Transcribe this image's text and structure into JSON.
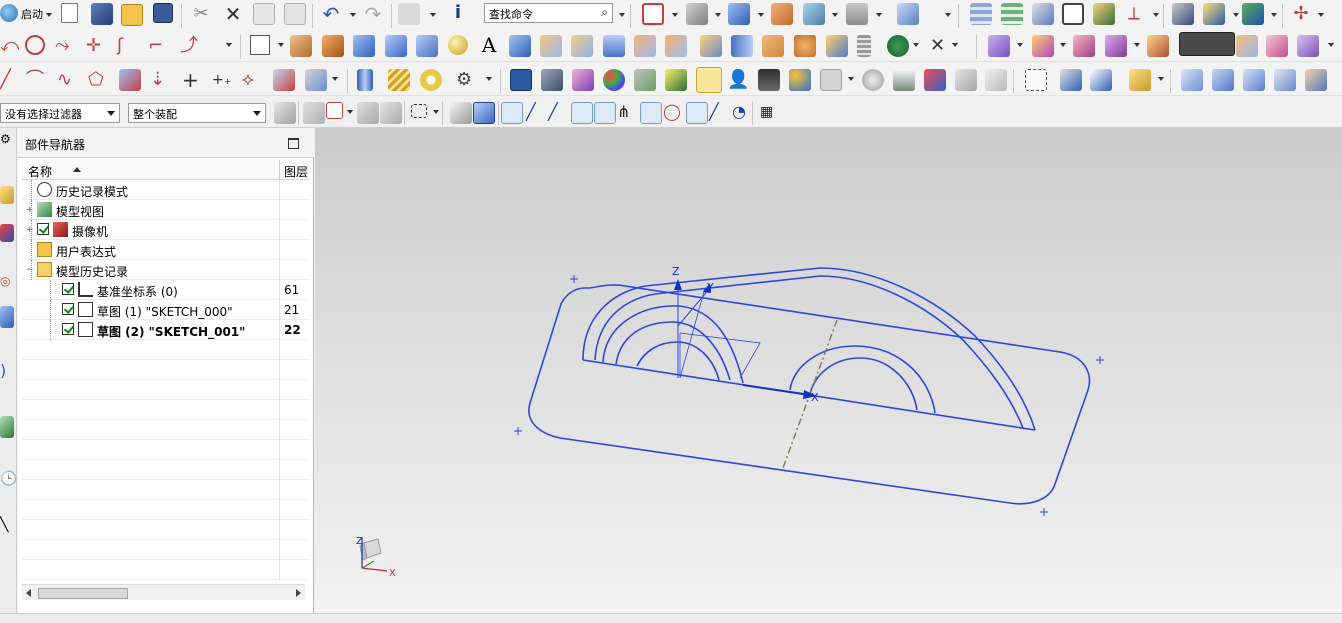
{
  "toolbar": {
    "start_label": "启动",
    "command_search": {
      "placeholder": "查找命令"
    },
    "selection_filter": "没有选择过滤器",
    "scope": "整个装配",
    "text_tool_glyph": "A"
  },
  "navigator": {
    "title": "部件导航器",
    "columns": {
      "name": "名称",
      "layer": "图层"
    },
    "items": [
      {
        "label": "历史记录模式",
        "icon": "clock-icon",
        "expander": "",
        "checked": false,
        "layer": "",
        "bold": false,
        "indent": 0
      },
      {
        "label": "模型视图",
        "icon": "model-views-icon",
        "expander": "+",
        "checked": false,
        "layer": "",
        "bold": false,
        "indent": 0
      },
      {
        "label": "摄像机",
        "icon": "camera-icon",
        "expander": "+",
        "checked": true,
        "layer": "",
        "bold": false,
        "indent": 0
      },
      {
        "label": "用户表达式",
        "icon": "folder-icon",
        "expander": "",
        "checked": false,
        "layer": "",
        "bold": false,
        "indent": 0
      },
      {
        "label": "模型历史记录",
        "icon": "open-folder-icon",
        "expander": "−",
        "checked": false,
        "layer": "",
        "bold": false,
        "indent": 0
      },
      {
        "label": "基准坐标系 (0)",
        "icon": "datum-csys-icon",
        "expander": "",
        "checked": true,
        "layer": "61",
        "bold": false,
        "indent": 1
      },
      {
        "label": "草图 (1) \"SKETCH_000\"",
        "icon": "sketch-icon",
        "expander": "",
        "checked": true,
        "layer": "21",
        "bold": false,
        "indent": 1
      },
      {
        "label": "草图 (2) \"SKETCH_001\"",
        "icon": "sketch-icon",
        "expander": "",
        "checked": true,
        "layer": "22",
        "bold": true,
        "indent": 1
      }
    ]
  },
  "viewport": {
    "sketch_color": "#2f46e6",
    "axis_labels": {
      "z": "Z",
      "y": "Y",
      "x": "X"
    },
    "triad_labels": {
      "z": "Z",
      "x": "X"
    }
  }
}
